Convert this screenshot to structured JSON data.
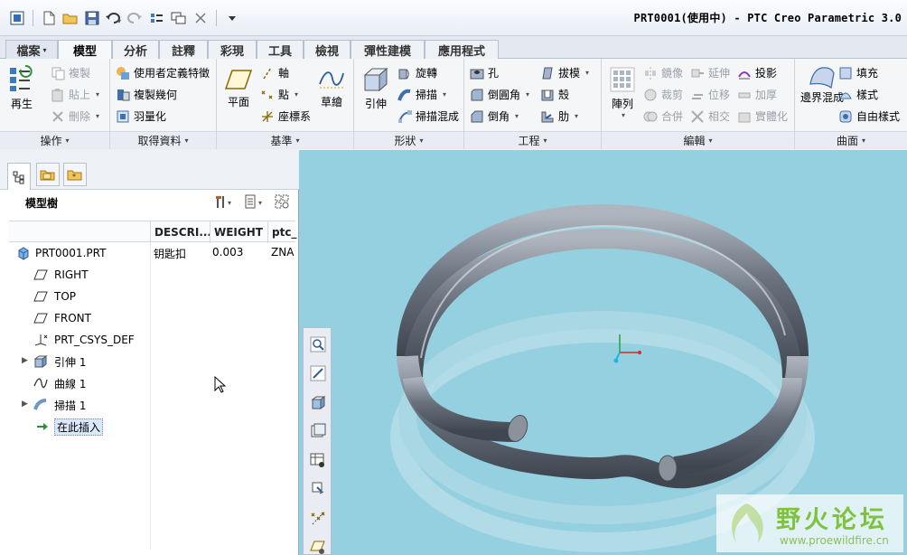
{
  "window": {
    "title": "PRT0001(使用中) - PTC Creo Parametric 3.0"
  },
  "quick_access": [
    "new-icon",
    "open-icon",
    "save-icon",
    "undo-icon",
    "redo-icon",
    "regenerate-icon",
    "windows-icon",
    "close-window-icon",
    "customize-icon"
  ],
  "tabs": [
    {
      "label": "檔案"
    },
    {
      "label": "模型"
    },
    {
      "label": "分析"
    },
    {
      "label": "註釋"
    },
    {
      "label": "彩現"
    },
    {
      "label": "工具"
    },
    {
      "label": "檢視"
    },
    {
      "label": "彈性建模"
    },
    {
      "label": "應用程式"
    }
  ],
  "ribbon": {
    "operations": {
      "label": "操作",
      "regenerate": "再生",
      "copy": "複製",
      "paste": "貼上",
      "delete": "刪除"
    },
    "get_data": {
      "label": "取得資料",
      "udf": "使用者定義特徵",
      "copy_geom": "複製幾何",
      "shrinkwrap": "羽量化"
    },
    "datum": {
      "label": "基準",
      "plane": "平面",
      "axis": "軸",
      "point": "點",
      "csys": "座標系",
      "sketch": "草繪"
    },
    "shapes": {
      "label": "形狀",
      "extrude": "引伸",
      "revolve": "旋轉",
      "sweep": "掃描",
      "swept_blend": "掃描混成"
    },
    "engineering": {
      "label": "工程",
      "hole": "孔",
      "round": "倒圓角",
      "chamfer": "倒角",
      "draft": "拔模",
      "shell": "殼",
      "rib": "肋"
    },
    "editing": {
      "label": "編輯",
      "pattern": "陣列",
      "mirror": "鏡像",
      "extend": "延伸",
      "project": "投影",
      "trim": "裁剪",
      "offset": "位移",
      "thicken": "加厚",
      "merge": "合併",
      "intersect": "相交",
      "solidify": "實體化"
    },
    "surfaces": {
      "label": "曲面",
      "boundary_blend": "邊界混成",
      "fill": "填充",
      "style": "樣式",
      "freestyle": "自由樣式"
    }
  },
  "model_tree": {
    "title": "模型樹",
    "columns": [
      "DESCRI...",
      "WEIGHT",
      "ptc_"
    ],
    "root": {
      "name": "PRT0001.PRT",
      "description": "钥匙扣",
      "weight": "0.003",
      "ptc": "ZNA"
    },
    "items": [
      {
        "label": "RIGHT"
      },
      {
        "label": "TOP"
      },
      {
        "label": "FRONT"
      },
      {
        "label": "PRT_CSYS_DEF"
      },
      {
        "label": "引伸 1"
      },
      {
        "label": "曲線 1"
      },
      {
        "label": "掃描 1"
      },
      {
        "label": "在此插入"
      }
    ]
  },
  "viewport": {
    "background": "#95d0e0",
    "model": "keyring-coil"
  },
  "view_toolbar": [
    "zoom-icon",
    "refit-icon",
    "display-style-icon",
    "saved-views-icon",
    "view-manager-icon",
    "perspective-icon",
    "datum-display-icon",
    "annotation-display-icon"
  ],
  "watermark": {
    "text": "野火论坛",
    "url": "www.proewildfire.cn"
  }
}
